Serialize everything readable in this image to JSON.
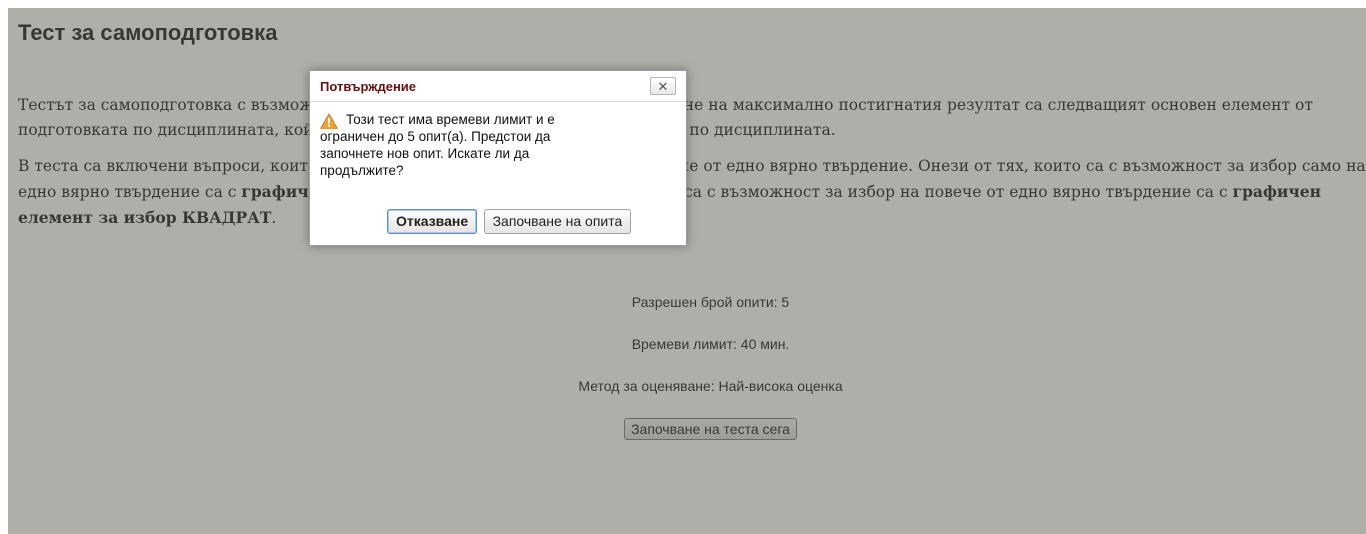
{
  "page": {
    "title": "Тест за самоподготовка",
    "intro_paragraph_1": "Тестът за самоподготовка с възможност за многократно решаване и регистриране на максимално постигнатия резултат са следващият основен елемент от подготовката по дисциплината, който влиза при формиране на крайната оценка по дисциплината.",
    "intro_paragraph_2_parts": [
      {
        "text": "В теста са включени въпроси, които са с възможност за избор на едно или повече от едно вярно твърдение. Онези от тях, които са с възможност за избор само на едно вярно твърдение са с ",
        "bold": false
      },
      {
        "text": "графичен елемент за избор КРЪГ",
        "bold": true
      },
      {
        "text": ", а онези, които са с възможност за избор на повече от едно вярно твърдение са с ",
        "bold": false
      },
      {
        "text": "графичен елемент за избор КВАДРАТ",
        "bold": true
      },
      {
        "text": ".",
        "bold": false
      }
    ]
  },
  "quiz_info": {
    "attempts_allowed": "Разрешен брой опити: 5",
    "time_limit": "Времеви лимит: 40 мин.",
    "grading_method": "Метод за оценяване: Най-висока оценка",
    "start_button_label": "Започване на теста сега"
  },
  "dialog": {
    "title": "Потвърждение",
    "close_glyph": "✕",
    "icon": "warning-icon",
    "message": "Този тест има времеви лимит и е ограничен до 5 опит(а). Предстои да започнете нов опит. Искате ли да продължите?",
    "cancel_label": "Отказване",
    "confirm_label": "Започване на опита"
  },
  "colors": {
    "overlay": "#8a8a80",
    "dialog_title": "#6b1010",
    "warning": "#f0a030"
  }
}
